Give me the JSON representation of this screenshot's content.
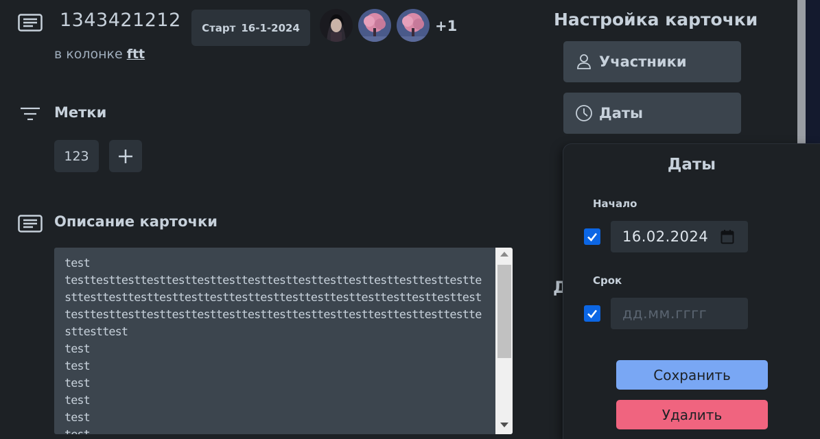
{
  "card": {
    "title": "1343421212",
    "start_badge": {
      "label": "Старт",
      "date": "16-1-2024"
    },
    "extra_members": "+1",
    "column_prefix": "в колонке",
    "column_name": "ftt"
  },
  "labels": {
    "title": "Метки",
    "items": [
      "123"
    ]
  },
  "description": {
    "title": "Описание карточки",
    "text": "test\ntesttesttesttesttesttesttesttesttesttesttesttesttesttesttesttestte\nsttesttesttesttesttesttesttesttesttesttesttesttesttesttesttesttest\ntesttesttesttesttesttesttesttesttesttesttesttesttesttesttesttestte\nsttesttest\ntest\ntest\ntest\ntest\ntest\ntest"
  },
  "settings": {
    "title": "Настройка карточки",
    "members_label": "Участники",
    "dates_label": "Даты",
    "partial_heading": "Д"
  },
  "dates_popover": {
    "title": "Даты",
    "start_label": "Начало",
    "start_value": "16.02.2024",
    "start_checked": true,
    "due_label": "Срок",
    "due_placeholder": "дд.мм.гггг",
    "due_checked": true,
    "save_label": "Сохранить",
    "delete_label": "Удалить"
  },
  "colors": {
    "background": "#1d2125",
    "accent_blue": "#79a7f4",
    "danger_pink": "#f0647f",
    "checkbox_blue": "#0c66e4"
  }
}
